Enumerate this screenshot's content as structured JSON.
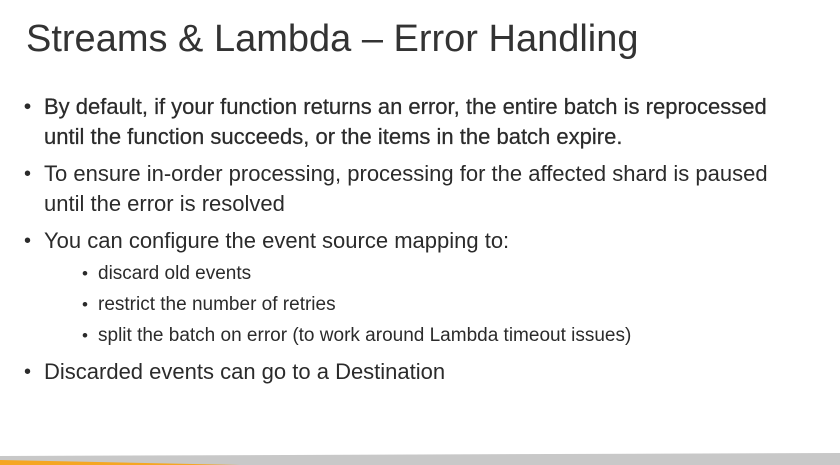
{
  "slide": {
    "title": "Streams & Lambda – Error Handling",
    "bullets": [
      {
        "text": "By default, if your function returns an error, the entire batch is reprocessed until the function succeeds, or the items in the batch expire."
      },
      {
        "text": "To ensure in-order processing, processing for the affected shard is paused until the error is resolved"
      },
      {
        "text": "You can configure the event source mapping to:"
      },
      {
        "text_before": "Discarded events can go to a ",
        "emphasis": "Destination"
      }
    ],
    "sub_bullets": [
      {
        "text": "discard old events"
      },
      {
        "text": "restrict the number of retries"
      },
      {
        "text": "split the batch on error (to work around Lambda timeout issues)"
      }
    ],
    "bullet_char": "•"
  },
  "theme": {
    "text_color": "#2b2b2b",
    "accent_orange": "#f5a623",
    "band_grey": "#c8c8c8"
  }
}
